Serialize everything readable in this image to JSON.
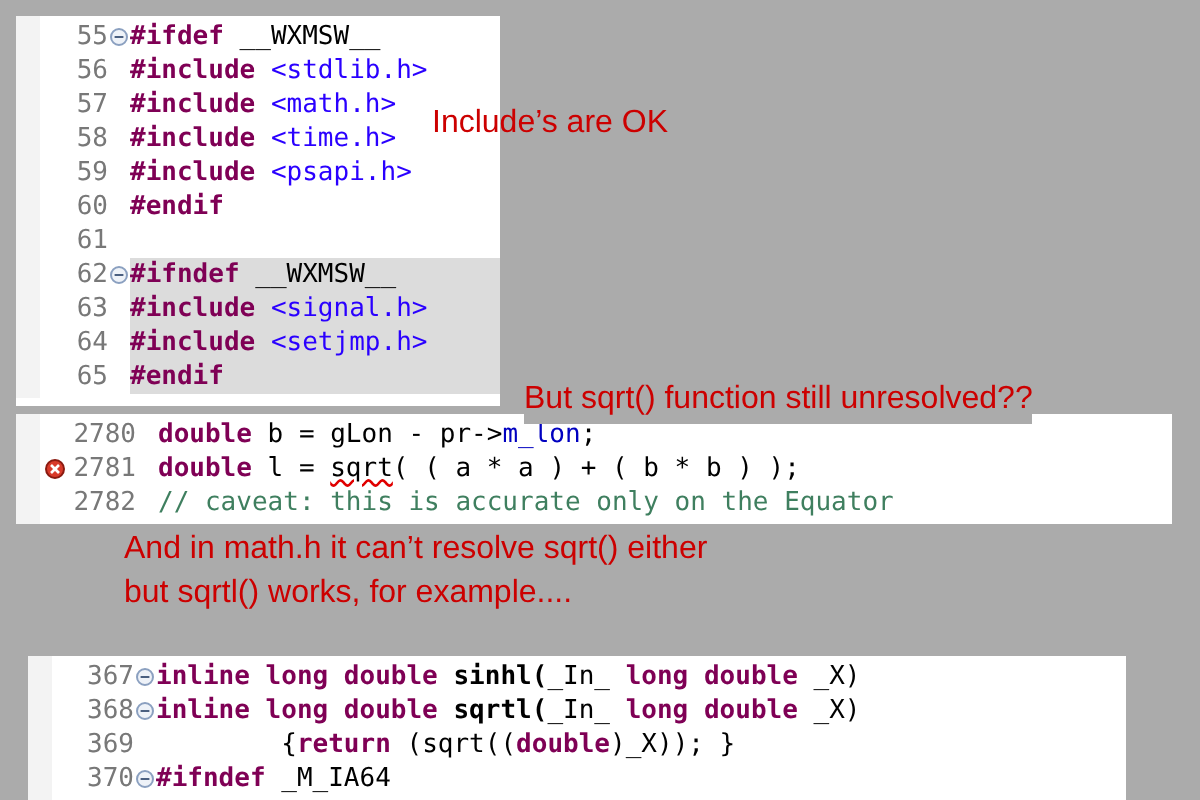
{
  "snippets": [
    {
      "lines": [
        {
          "number": "55",
          "fold": true,
          "highlighted": false,
          "tokens": [
            {
              "text": "#ifdef",
              "kind": "keyword"
            },
            {
              "text": " __WXMSW__",
              "kind": "plain"
            }
          ]
        },
        {
          "number": "56",
          "fold": false,
          "highlighted": false,
          "tokens": [
            {
              "text": "#include",
              "kind": "keyword"
            },
            {
              "text": " <stdlib.h>",
              "kind": "string"
            }
          ]
        },
        {
          "number": "57",
          "fold": false,
          "highlighted": false,
          "tokens": [
            {
              "text": "#include",
              "kind": "keyword"
            },
            {
              "text": " <math.h>",
              "kind": "string"
            }
          ]
        },
        {
          "number": "58",
          "fold": false,
          "highlighted": false,
          "tokens": [
            {
              "text": "#include",
              "kind": "keyword"
            },
            {
              "text": " <time.h>",
              "kind": "string"
            }
          ]
        },
        {
          "number": "59",
          "fold": false,
          "highlighted": false,
          "tokens": [
            {
              "text": "#include",
              "kind": "keyword"
            },
            {
              "text": " <psapi.h>",
              "kind": "string"
            }
          ]
        },
        {
          "number": "60",
          "fold": false,
          "highlighted": false,
          "tokens": [
            {
              "text": "#endif",
              "kind": "keyword"
            }
          ]
        },
        {
          "number": "61",
          "fold": false,
          "highlighted": false
        },
        {
          "number": "62",
          "fold": true,
          "highlighted": true,
          "tokens": [
            {
              "text": "#ifndef",
              "kind": "keyword"
            },
            {
              "text": " __WXMSW__",
              "kind": "plain"
            }
          ]
        },
        {
          "number": "63",
          "fold": false,
          "highlighted": true,
          "tokens": [
            {
              "text": "#include",
              "kind": "keyword"
            },
            {
              "text": " <signal.h>",
              "kind": "string"
            }
          ]
        },
        {
          "number": "64",
          "fold": false,
          "highlighted": true,
          "tokens": [
            {
              "text": "#include",
              "kind": "keyword"
            },
            {
              "text": " <setjmp.h>",
              "kind": "string"
            }
          ]
        },
        {
          "number": "65",
          "fold": false,
          "highlighted": true,
          "tokens": [
            {
              "text": "#endif",
              "kind": "keyword"
            }
          ]
        }
      ]
    },
    {
      "lines": [
        {
          "number": "2780",
          "error": false,
          "fold": false,
          "highlighted": false,
          "tokens": [
            {
              "text": "double",
              "kind": "keyword"
            },
            {
              "text": " b = gLon - pr->",
              "kind": "plain"
            },
            {
              "text": "m_lon",
              "kind": "field"
            },
            {
              "text": ";",
              "kind": "plain"
            }
          ]
        },
        {
          "number": "2781",
          "error": true,
          "fold": false,
          "highlighted": false,
          "tokens": [
            {
              "text": "double",
              "kind": "keyword"
            },
            {
              "text": " l = ",
              "kind": "plain"
            },
            {
              "text": "sqrt",
              "kind": "error"
            },
            {
              "text": "( ( a * a ) + ( b * b ) );",
              "kind": "plain"
            }
          ]
        },
        {
          "number": "2782",
          "error": false,
          "fold": false,
          "highlighted": false,
          "tokens": [
            {
              "text": "// caveat: this is accurate only on the Equator",
              "kind": "comment"
            }
          ]
        }
      ]
    },
    {
      "lines": [
        {
          "number": "367",
          "fold": true,
          "highlighted": false,
          "tokens": [
            {
              "text": "inline long double",
              "kind": "keyword"
            },
            {
              "text": " sinhl(",
              "kind": "bold"
            },
            {
              "text": "_In_ ",
              "kind": "plain"
            },
            {
              "text": "long double",
              "kind": "keyword"
            },
            {
              "text": " _X)",
              "kind": "plain"
            }
          ]
        },
        {
          "number": "368",
          "fold": true,
          "highlighted": false,
          "tokens": [
            {
              "text": "inline long double",
              "kind": "keyword"
            },
            {
              "text": " sqrtl(",
              "kind": "bold"
            },
            {
              "text": "_In_ ",
              "kind": "plain"
            },
            {
              "text": "long double",
              "kind": "keyword"
            },
            {
              "text": " _X)",
              "kind": "plain"
            }
          ]
        },
        {
          "number": "369",
          "fold": false,
          "highlighted": false,
          "tokens": [
            {
              "text": "        {",
              "kind": "plain"
            },
            {
              "text": "return",
              "kind": "keyword"
            },
            {
              "text": " (sqrt((",
              "kind": "plain"
            },
            {
              "text": "double",
              "kind": "keyword"
            },
            {
              "text": ")_X)); }",
              "kind": "plain"
            }
          ]
        },
        {
          "number": "370",
          "fold": true,
          "highlighted": false,
          "tokens": [
            {
              "text": "#ifndef",
              "kind": "keyword"
            },
            {
              "text": " _M_IA64",
              "kind": "plain"
            }
          ]
        }
      ]
    }
  ],
  "annotations": [
    "Include’s are OK",
    "But sqrt() function still unresolved??",
    "And in math.h it can’t resolve sqrt() either",
    "but sqrtl() works, for example...."
  ]
}
